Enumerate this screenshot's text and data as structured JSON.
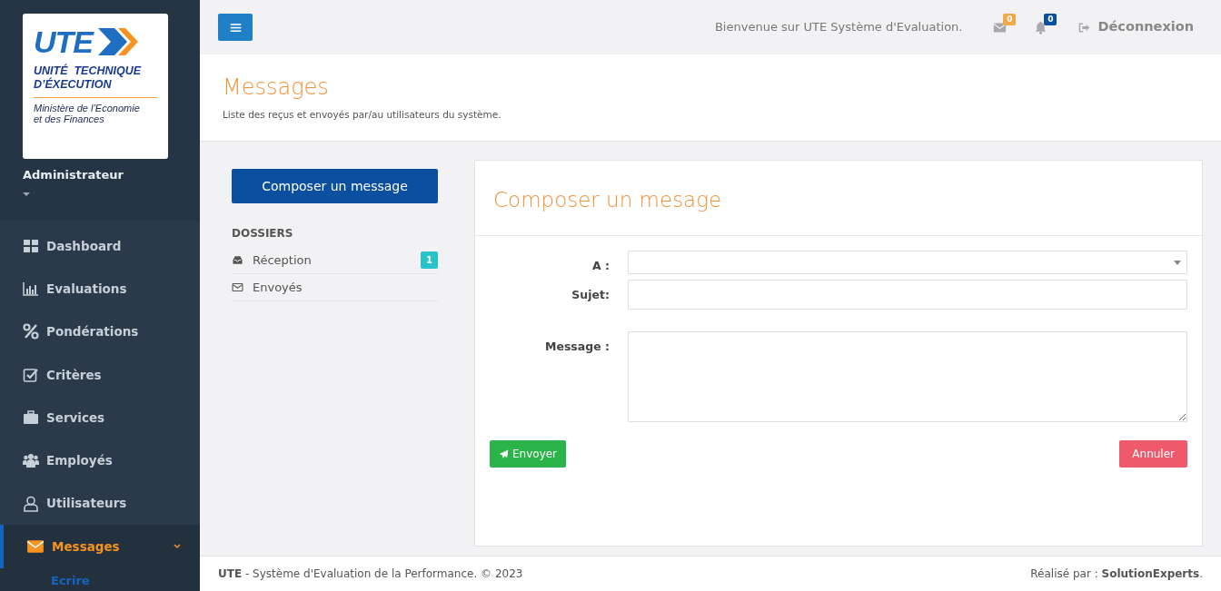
{
  "sidebar": {
    "logo": {
      "acronym": "UTE",
      "line_1": "UNITÉ  TECHNIQUE",
      "line_2": "D’ÉXECUTION",
      "ministry_1": "Ministère de l’Economie",
      "ministry_2": "et des Finances"
    },
    "user": "Administrateur",
    "items": [
      {
        "label": "Dashboard",
        "selected": false
      },
      {
        "label": "Evaluations",
        "selected": false
      },
      {
        "label": "Pondérations",
        "selected": false
      },
      {
        "label": "Critères",
        "selected": false
      },
      {
        "label": "Services",
        "selected": false
      },
      {
        "label": "Employés",
        "selected": false
      },
      {
        "label": "Utilisateurs",
        "selected": false
      },
      {
        "label": "Messages",
        "selected": true,
        "expanded": true,
        "children": [
          {
            "label": "Ecrire"
          }
        ]
      }
    ]
  },
  "topbar": {
    "welcome": "Bienvenue sur UTE Système d'Evaluation.",
    "mail_count": "0",
    "alert_count": "0",
    "logout": "Déconnexion"
  },
  "page_header": {
    "title": "Messages",
    "subtitle": "Liste des reçus et envoyés par/au utilisateurs du système."
  },
  "folders": {
    "compose": "Composer un message",
    "heading": "DOSSIERS",
    "items": [
      {
        "label": "Réception",
        "badge": "1"
      },
      {
        "label": "Envoyés"
      }
    ]
  },
  "form": {
    "title": "Composer un mesage",
    "fields": [
      {
        "label": "A :",
        "kind": "select"
      },
      {
        "label": "Sujet:",
        "kind": "text"
      },
      {
        "label": "Message :",
        "kind": "textarea"
      }
    ],
    "send": "Envoyer",
    "cancel": "Annuler"
  },
  "footer": {
    "left": "**UTE** - Système d'Evaluation de la Performance. © 2023",
    "right": "Réalisé par : **SolutionExperts**."
  }
}
